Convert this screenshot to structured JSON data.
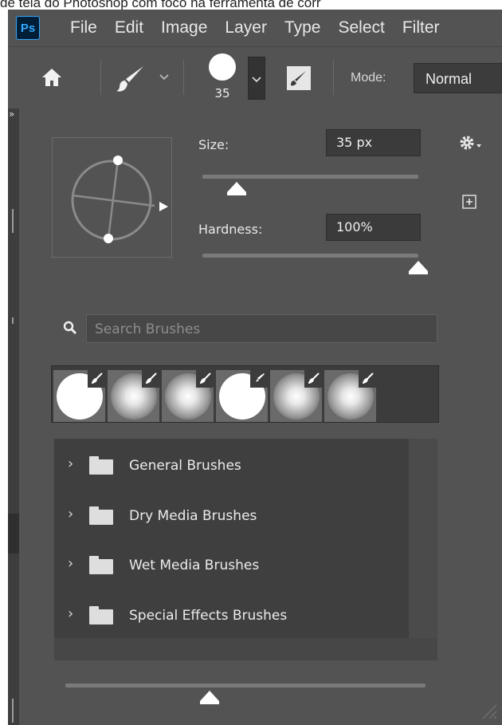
{
  "caption": "de tela do Photoshop com foco na ferramenta de corr",
  "app": {
    "logo": "Ps"
  },
  "menu": [
    "File",
    "Edit",
    "Image",
    "Layer",
    "Type",
    "Select",
    "Filter"
  ],
  "options_bar": {
    "brush_size": "35",
    "mode_label": "Mode:",
    "mode_value": "Normal"
  },
  "brush_panel": {
    "collapse_glyph": "»",
    "size_label": "Size:",
    "size_value": "35 px",
    "hardness_label": "Hardness:",
    "hardness_value": "100%",
    "size_level_fraction": 0.16,
    "hardness_level_fraction": 1.0,
    "search_placeholder": "Search Brushes",
    "preset_tips": [
      {
        "type": "hard"
      },
      {
        "type": "soft"
      },
      {
        "type": "soft"
      },
      {
        "type": "hard"
      },
      {
        "type": "soft"
      },
      {
        "type": "soft"
      }
    ],
    "groups": [
      {
        "name": "General Brushes"
      },
      {
        "name": "Dry Media Brushes"
      },
      {
        "name": "Wet Media Brushes"
      },
      {
        "name": "Special Effects Brushes"
      }
    ],
    "preview_size_fraction": 0.4
  },
  "colors": {
    "panel_bg": "#535353",
    "field_bg": "#3b3b3b",
    "accent": "#31a8ff"
  }
}
